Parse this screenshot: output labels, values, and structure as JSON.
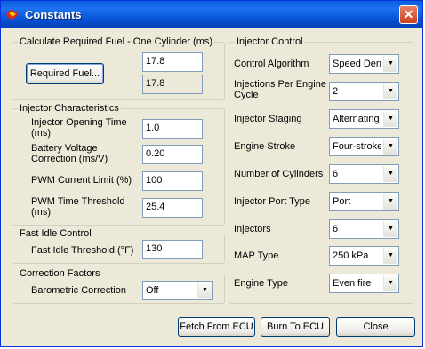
{
  "window": {
    "title": "Constants",
    "close_glyph": "✕"
  },
  "required_fuel": {
    "group_label": "Calculate Required Fuel - One Cylinder (ms)",
    "button_label": "Required Fuel...",
    "value": "17.8",
    "computed": "17.8"
  },
  "injector_characteristics": {
    "group_label": "Injector Characteristics",
    "opening_time": {
      "label": "Injector Opening Time (ms)",
      "value": "1.0"
    },
    "battery_correction": {
      "label": "Battery Voltage Correction (ms/V)",
      "value": "0.20"
    },
    "pwm_current_limit": {
      "label": "PWM Current Limit (%)",
      "value": "100"
    },
    "pwm_time_threshold": {
      "label": "PWM Time Threshold (ms)",
      "value": "25.4"
    }
  },
  "fast_idle": {
    "group_label": "Fast Idle Control",
    "threshold": {
      "label": "Fast Idle Threshold (°F)",
      "value": "130"
    }
  },
  "correction_factors": {
    "group_label": "Correction Factors",
    "barometric": {
      "label": "Barometric Correction",
      "value": "Off"
    }
  },
  "injector_control": {
    "group_label": "Injector Control",
    "control_algorithm": {
      "label": "Control Algorithm",
      "value": "Speed Den:"
    },
    "injections_per_cycle": {
      "label": "Injections Per Engine Cycle",
      "value": "2"
    },
    "injector_staging": {
      "label": "Injector Staging",
      "value": "Alternating"
    },
    "engine_stroke": {
      "label": "Engine Stroke",
      "value": "Four-stroke"
    },
    "number_of_cylinders": {
      "label": "Number of Cylinders",
      "value": "6"
    },
    "injector_port_type": {
      "label": "Injector Port Type",
      "value": "Port"
    },
    "injectors": {
      "label": "Injectors",
      "value": "6"
    },
    "map_type": {
      "label": "MAP Type",
      "value": "250 kPa"
    },
    "engine_type": {
      "label": "Engine Type",
      "value": "Even fire"
    }
  },
  "buttons": {
    "fetch": "Fetch From ECU",
    "burn": "Burn To ECU",
    "close": "Close"
  }
}
